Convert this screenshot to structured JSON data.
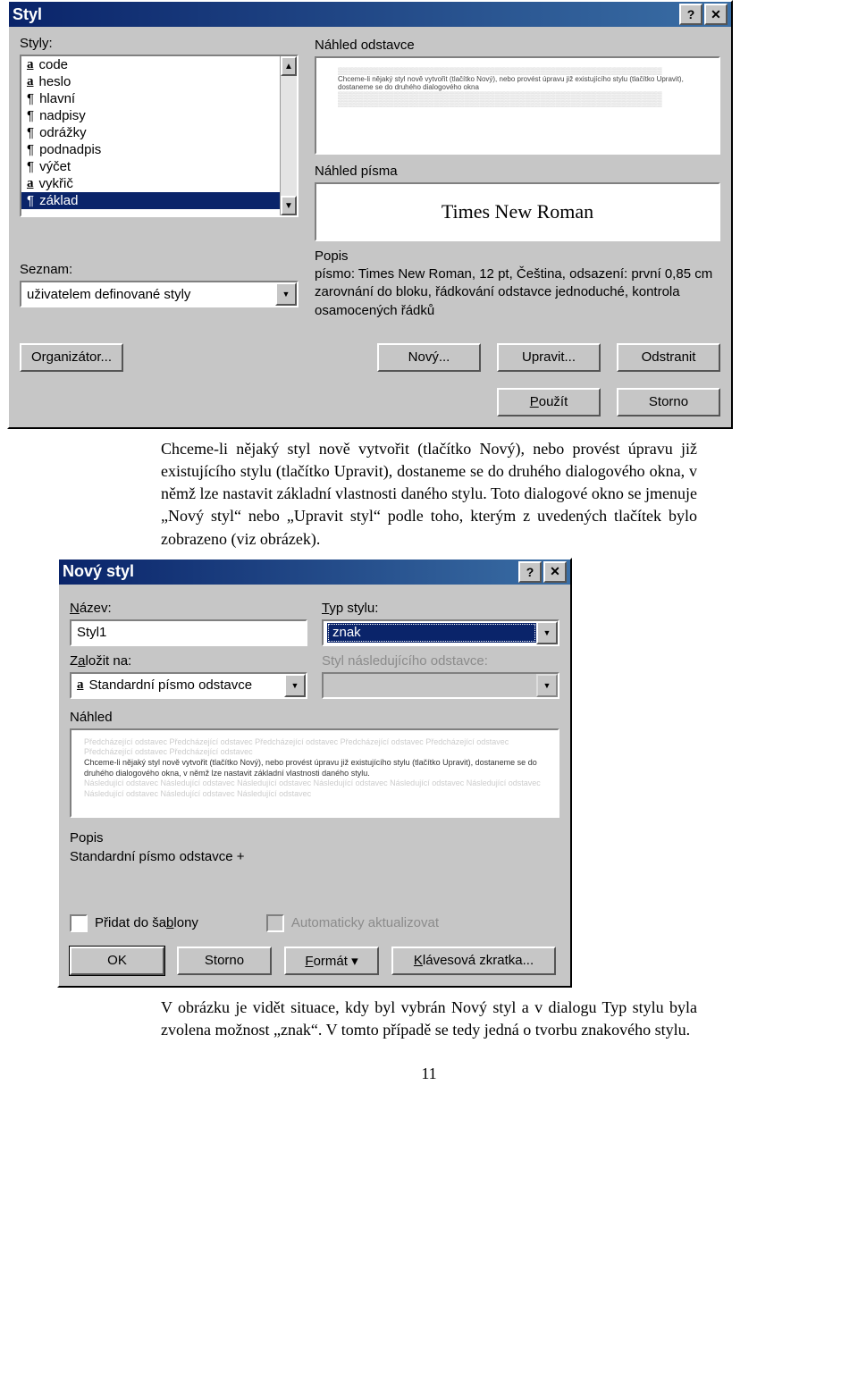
{
  "dialog1": {
    "title": "Styl",
    "styles_label": "Styly:",
    "styles": [
      {
        "icon": "a",
        "label": "code"
      },
      {
        "icon": "a",
        "label": "heslo"
      },
      {
        "icon": "¶",
        "label": "hlavní"
      },
      {
        "icon": "¶",
        "label": "nadpisy"
      },
      {
        "icon": "¶",
        "label": "odrážky"
      },
      {
        "icon": "¶",
        "label": "podnadpis"
      },
      {
        "icon": "¶",
        "label": "výčet"
      },
      {
        "icon": "a",
        "label": "vykřič"
      },
      {
        "icon": "¶",
        "label": "základ",
        "selected": true
      }
    ],
    "seznam_label": "Seznam:",
    "seznam_value": "uživatelem definované styly",
    "preview_para_label": "Náhled odstavce",
    "preview_font_label": "Náhled písma",
    "preview_font_value": "Times New Roman",
    "desc_label": "Popis",
    "desc_text": "písmo: Times New Roman, 12 pt, Čeština, odsazení: první 0,85 cm zarovnání do bloku, řádkování odstavce jednoduché, kontrola osamocených řádků",
    "buttons": {
      "organizator": "Organizátor...",
      "novy": "Nový...",
      "upravit": "Upravit...",
      "odstranit": "Odstranit",
      "pouzit": "Použít",
      "storno": "Storno"
    }
  },
  "paragraph1": "Chceme-li nějaký styl nově vytvořit (tlačítko Nový), nebo provést úpravu již existujícího stylu (tlačítko Upravit), dostaneme se do druhého dialogového okna, v němž lze nastavit základní vlastnosti daného stylu. Toto dialogové okno se jmenuje „Nový styl“ nebo „Upravit styl“ podle toho, kterým z uvedených tlačítek bylo zobrazeno (viz obrázek).",
  "dialog2": {
    "title": "Nový styl",
    "nazev_label": "Název:",
    "nazev_value": "Styl1",
    "typ_label": "Typ stylu:",
    "typ_value": "znak",
    "zalozit_label": "Založit na:",
    "zalozit_value": "Standardní písmo odstavce",
    "nasled_label": "Styl následujícího odstavce:",
    "nahled_label": "Náhled",
    "popis_label": "Popis",
    "popis_value": "Standardní písmo odstavce +",
    "check1": "Přidat do šablony",
    "check2": "Automaticky aktualizovat",
    "buttons": {
      "ok": "OK",
      "storno": "Storno",
      "format": "Formát ▾",
      "klaves": "Klávesová zkratka..."
    }
  },
  "paragraph2": "V obrázku je vidět situace, kdy byl vybrán Nový styl a v dialogu Typ stylu byla zvolena možnost „znak“. V tomto případě se tedy jedná o tvorbu znakového stylu.",
  "page_number": "11"
}
